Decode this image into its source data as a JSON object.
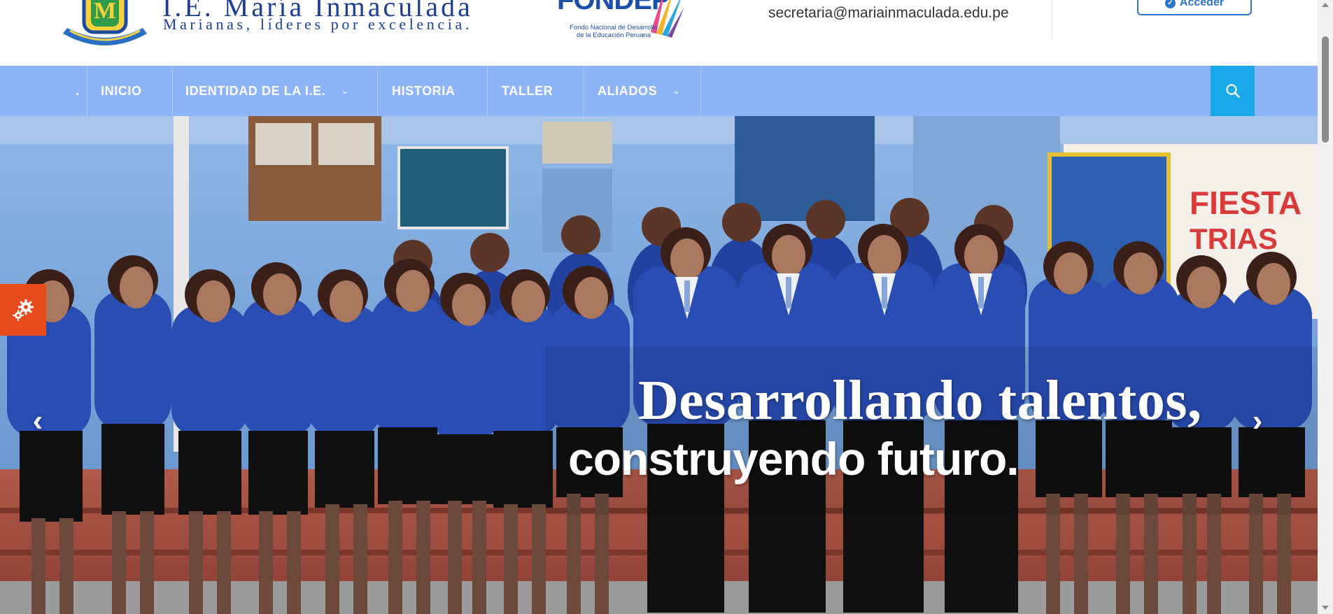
{
  "header": {
    "school_title": "I.E. María Inmaculada",
    "school_tagline": "Marianas, líderes por excelencia.",
    "partner_logo_word": "FONDEP",
    "partner_logo_sub": "Fondo Nacional de Desarrollo de la Educación Peruana",
    "crest_icon": "school-crest-icon",
    "email": "secretaria@mariainmaculada.edu.pe",
    "login_label": "Acceder",
    "login_icon": "lock-circle-icon"
  },
  "nav": {
    "items": [
      {
        "label": ".",
        "has_dropdown": false
      },
      {
        "label": "INICIO",
        "has_dropdown": false
      },
      {
        "label": "IDENTIDAD DE LA I.E.",
        "has_dropdown": true
      },
      {
        "label": "HISTORIA",
        "has_dropdown": false
      },
      {
        "label": "TALLER",
        "has_dropdown": false
      },
      {
        "label": "ALIADOS",
        "has_dropdown": true
      }
    ],
    "search_icon": "search-icon",
    "chevron": "⌄"
  },
  "slider": {
    "caption_line1": "Desarrollando talentos,",
    "caption_line2": "construyendo futuro.",
    "prev_arrow": "‹",
    "next_arrow": "›",
    "settings_icon": "gear-icon"
  },
  "colors": {
    "nav_bg": "#8cb4f7",
    "search_bg": "#19a8e8",
    "settings_tab": "#e74c1f",
    "brand_blue": "#1c3f94"
  }
}
